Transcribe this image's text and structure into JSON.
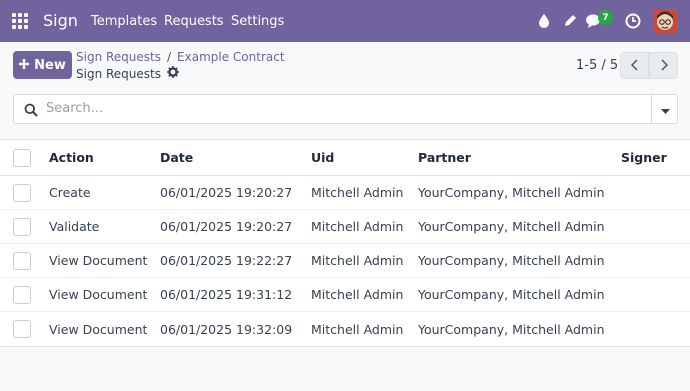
{
  "navbar": {
    "brand": "Sign",
    "menu": [
      "Templates",
      "Requests",
      "Settings"
    ],
    "chat_count": "7",
    "accent": "#71639e",
    "icons": [
      "apps-grid-icon",
      "drop-icon",
      "pencil-icon",
      "chat-icon",
      "clock-icon",
      "avatar"
    ]
  },
  "control": {
    "new_label": "New",
    "breadcrumb": [
      "Sign Requests",
      "Example Contract"
    ],
    "breadcrumb_sep": "/",
    "page_title": "Sign Requests",
    "pager": "1-5 / 5"
  },
  "search": {
    "placeholder": "Search..."
  },
  "table": {
    "headers": [
      "Action",
      "Date",
      "Uid",
      "Partner",
      "Signer"
    ],
    "rows": [
      [
        "Create",
        "06/01/2025 19:20:27",
        "Mitchell Admin",
        "YourCompany, Mitchell Admin",
        ""
      ],
      [
        "Validate",
        "06/01/2025 19:20:27",
        "Mitchell Admin",
        "YourCompany, Mitchell Admin",
        ""
      ],
      [
        "View Document",
        "06/01/2025 19:22:27",
        "Mitchell Admin",
        "YourCompany, Mitchell Admin",
        ""
      ],
      [
        "View Document",
        "06/01/2025 19:31:12",
        "Mitchell Admin",
        "YourCompany, Mitchell Admin",
        ""
      ],
      [
        "View Document",
        "06/01/2025 19:32:09",
        "Mitchell Admin",
        "YourCompany, Mitchell Admin",
        ""
      ]
    ]
  }
}
